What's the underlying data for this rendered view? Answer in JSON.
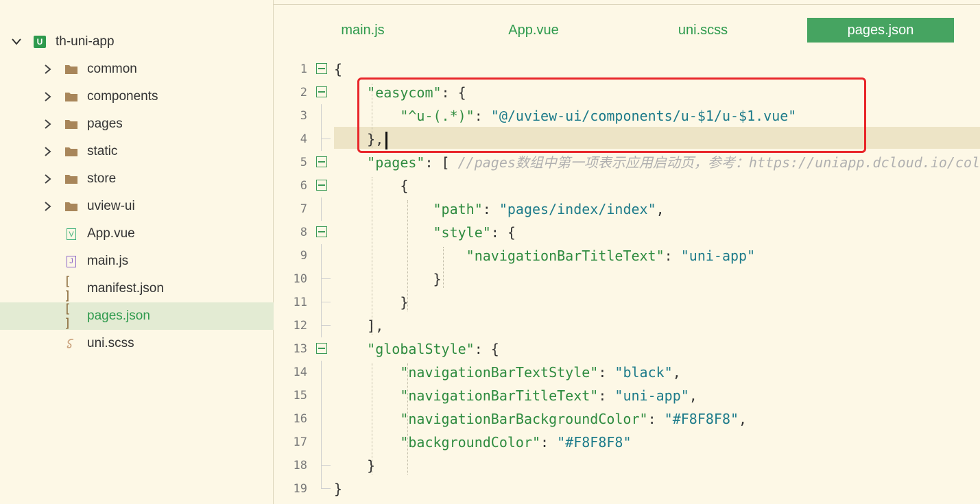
{
  "project": {
    "name": "th-uni-app",
    "badge": "U"
  },
  "tree": [
    {
      "label": "common",
      "type": "folder"
    },
    {
      "label": "components",
      "type": "folder"
    },
    {
      "label": "pages",
      "type": "folder"
    },
    {
      "label": "static",
      "type": "folder"
    },
    {
      "label": "store",
      "type": "folder"
    },
    {
      "label": "uview-ui",
      "type": "folder"
    },
    {
      "label": "App.vue",
      "type": "vue"
    },
    {
      "label": "main.js",
      "type": "js"
    },
    {
      "label": "manifest.json",
      "type": "json"
    },
    {
      "label": "pages.json",
      "type": "json",
      "active": true
    },
    {
      "label": "uni.scss",
      "type": "scss"
    }
  ],
  "file_icons": {
    "json": "[ ]",
    "vue": "V",
    "js": "J"
  },
  "tabs": [
    {
      "label": "main.js",
      "active": false
    },
    {
      "label": "App.vue",
      "active": false
    },
    {
      "label": "uni.scss",
      "active": false
    },
    {
      "label": "pages.json",
      "active": true
    }
  ],
  "colors": {
    "accent": "#46a461",
    "highlight_box": "#e8262a",
    "background": "#fdf8e6"
  },
  "editor": {
    "lines": [
      {
        "n": "1",
        "segs": [
          [
            "p",
            "{"
          ]
        ]
      },
      {
        "n": "2",
        "segs": [
          [
            "p",
            "    "
          ],
          [
            "k",
            "\"easycom\""
          ],
          [
            "p",
            ": {"
          ]
        ]
      },
      {
        "n": "3",
        "segs": [
          [
            "p",
            "        "
          ],
          [
            "k",
            "\"^u-(.*)\""
          ],
          [
            "p",
            ": "
          ],
          [
            "s",
            "\"@/uview-ui/components/u-$1/u-$1.vue\""
          ]
        ]
      },
      {
        "n": "4",
        "segs": [
          [
            "p",
            "    },"
          ]
        ]
      },
      {
        "n": "5",
        "segs": [
          [
            "p",
            "    "
          ],
          [
            "k",
            "\"pages\""
          ],
          [
            "p",
            ": [ "
          ],
          [
            "c",
            "//pages数组中第一项表示应用启动页，参考：https://uniapp.dcloud.io/collocation/pages"
          ]
        ]
      },
      {
        "n": "6",
        "segs": [
          [
            "p",
            "        {"
          ]
        ]
      },
      {
        "n": "7",
        "segs": [
          [
            "p",
            "            "
          ],
          [
            "k",
            "\"path\""
          ],
          [
            "p",
            ": "
          ],
          [
            "s",
            "\"pages/index/index\""
          ],
          [
            "p",
            ","
          ]
        ]
      },
      {
        "n": "8",
        "segs": [
          [
            "p",
            "            "
          ],
          [
            "k",
            "\"style\""
          ],
          [
            "p",
            ": {"
          ]
        ]
      },
      {
        "n": "9",
        "segs": [
          [
            "p",
            "                "
          ],
          [
            "k",
            "\"navigationBarTitleText\""
          ],
          [
            "p",
            ": "
          ],
          [
            "s",
            "\"uni-app\""
          ]
        ]
      },
      {
        "n": "10",
        "segs": [
          [
            "p",
            "            }"
          ]
        ]
      },
      {
        "n": "11",
        "segs": [
          [
            "p",
            "        }"
          ]
        ]
      },
      {
        "n": "12",
        "segs": [
          [
            "p",
            "    ],"
          ]
        ]
      },
      {
        "n": "13",
        "segs": [
          [
            "p",
            "    "
          ],
          [
            "k",
            "\"globalStyle\""
          ],
          [
            "p",
            ": {"
          ]
        ]
      },
      {
        "n": "14",
        "segs": [
          [
            "p",
            "        "
          ],
          [
            "k",
            "\"navigationBarTextStyle\""
          ],
          [
            "p",
            ": "
          ],
          [
            "s",
            "\"black\""
          ],
          [
            "p",
            ","
          ]
        ]
      },
      {
        "n": "15",
        "segs": [
          [
            "p",
            "        "
          ],
          [
            "k",
            "\"navigationBarTitleText\""
          ],
          [
            "p",
            ": "
          ],
          [
            "s",
            "\"uni-app\""
          ],
          [
            "p",
            ","
          ]
        ]
      },
      {
        "n": "16",
        "segs": [
          [
            "p",
            "        "
          ],
          [
            "k",
            "\"navigationBarBackgroundColor\""
          ],
          [
            "p",
            ": "
          ],
          [
            "s",
            "\"#F8F8F8\""
          ],
          [
            "p",
            ","
          ]
        ]
      },
      {
        "n": "17",
        "segs": [
          [
            "p",
            "        "
          ],
          [
            "k",
            "\"backgroundColor\""
          ],
          [
            "p",
            ": "
          ],
          [
            "s",
            "\"#F8F8F8\""
          ]
        ]
      },
      {
        "n": "18",
        "segs": [
          [
            "p",
            "    }"
          ]
        ]
      },
      {
        "n": "19",
        "segs": [
          [
            "p",
            "}"
          ]
        ]
      }
    ]
  }
}
